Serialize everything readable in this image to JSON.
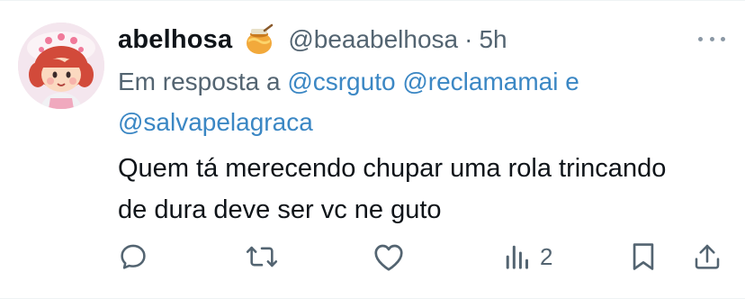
{
  "tweet": {
    "author": {
      "display_name": "abelhosa",
      "handle": "@beaabelhosa",
      "separator": "·",
      "timestamp": "5h",
      "avatar_icon": "strawberry-shortcake-avatar",
      "name_emoji": "honey-pot-icon"
    },
    "reply_to": {
      "prefix": "Em resposta a",
      "mentions": [
        "@csrguto",
        "@reclamamai"
      ],
      "conjunction": "e",
      "last_mention": "@salvapelagraca"
    },
    "text_line_1": "Quem tá merecendo chupar uma rola trincando",
    "text_line_2": "de dura deve ser vc ne guto",
    "actions": {
      "reply_icon": "reply-icon",
      "retweet_icon": "retweet-icon",
      "like_icon": "heart-icon",
      "views_icon": "views-icon",
      "views_count": "2",
      "bookmark_icon": "bookmark-icon",
      "share_icon": "share-icon"
    }
  },
  "colors": {
    "text_primary": "#0f1419",
    "text_secondary": "#536471",
    "mention": "#3b87c4",
    "icon": "#536471"
  }
}
